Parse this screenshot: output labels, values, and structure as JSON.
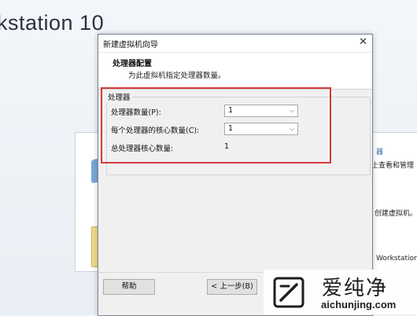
{
  "background": {
    "app_title": "kstation 10",
    "side_texts": [
      "器",
      "上查看和管理",
      "创建虚拟机。",
      "Workstation"
    ]
  },
  "dialog": {
    "title": "新建虚拟机向导",
    "heading": "处理器配置",
    "description": "为此虚拟机指定处理器数量。",
    "group_label": "处理器",
    "rows": {
      "processor_count_label": "处理器数量(P):",
      "processor_count_value": "1",
      "cores_per_processor_label": "每个处理器的核心数量(C):",
      "cores_per_processor_value": "1",
      "total_cores_label": "总处理器核心数量:",
      "total_cores_value": "1"
    },
    "buttons": {
      "help": "帮助",
      "back": "< 上一步(B)"
    }
  },
  "watermark": {
    "brand_cn": "爱纯净",
    "brand_en": "aichunjing.com"
  },
  "colors": {
    "highlight": "#d23c3c",
    "link_blue": "#3366aa"
  }
}
